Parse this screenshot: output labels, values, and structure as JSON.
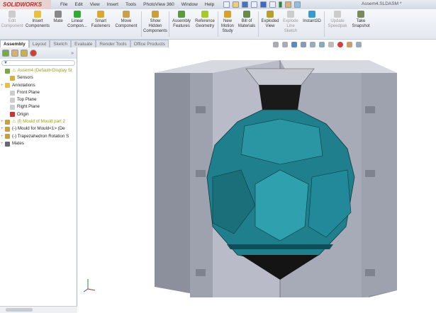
{
  "app": {
    "logo": "SOLIDWORKS",
    "document_title": "Assem4.SLDASM *"
  },
  "menu": [
    "File",
    "Edit",
    "View",
    "Insert",
    "Tools",
    "PhotoView 360",
    "Window",
    "Help"
  ],
  "ribbon": [
    {
      "label": "Edit Component",
      "enabled": false
    },
    {
      "label": "Insert Components",
      "enabled": true
    },
    {
      "label": "Mate",
      "enabled": true
    },
    {
      "label": "Linear Compon...",
      "enabled": true
    },
    {
      "label": "Smart Fasteners",
      "enabled": true
    },
    {
      "label": "Move Component",
      "enabled": true
    },
    {
      "label": "Show Hidden Components",
      "enabled": true
    },
    {
      "label": "Assembly Features",
      "enabled": true
    },
    {
      "label": "Reference Geometry",
      "enabled": true
    },
    {
      "label": "New Motion Study",
      "enabled": true
    },
    {
      "label": "Bill of Materials",
      "enabled": true
    },
    {
      "label": "Exploded View",
      "enabled": true
    },
    {
      "label": "Explode Line Sketch",
      "enabled": false
    },
    {
      "label": "Instant3D",
      "enabled": true
    },
    {
      "label": "Update Speedpak",
      "enabled": false
    },
    {
      "label": "Take Snapshot",
      "enabled": true
    }
  ],
  "tabs": [
    "Assembly",
    "Layout",
    "Sketch",
    "Evaluate",
    "Render Tools",
    "Office Products"
  ],
  "tree": [
    {
      "label": "Assem4  (Default<Display St",
      "warn": true,
      "exp": ""
    },
    {
      "label": "Sensors",
      "exp": ""
    },
    {
      "label": "Annotations",
      "exp": "+"
    },
    {
      "label": "Front Plane",
      "exp": ""
    },
    {
      "label": "Top Plane",
      "exp": ""
    },
    {
      "label": "Right Plane",
      "exp": ""
    },
    {
      "label": "Origin",
      "exp": ""
    },
    {
      "label": "(f) Mould of Mould part 2",
      "warn": true,
      "exp": "+"
    },
    {
      "label": "(-) Mould for Mould<1> (De",
      "exp": "+"
    },
    {
      "label": "(-) Trapezahedron Rotation S",
      "exp": "+"
    },
    {
      "label": "Mates",
      "exp": "+"
    }
  ],
  "colors": {
    "accent": "#1f7f8c",
    "mould": "#8e92a0"
  }
}
